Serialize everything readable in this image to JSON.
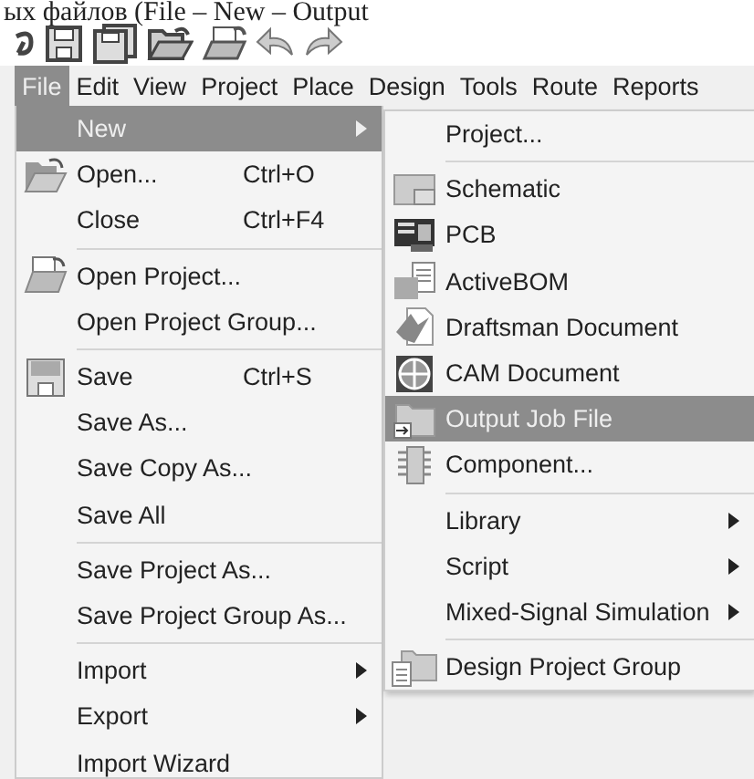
{
  "caption": "ых файлов (File – New – Output",
  "menubar": [
    {
      "label": "File",
      "selected": true
    },
    {
      "label": "Edit",
      "selected": false
    },
    {
      "label": "View",
      "selected": false
    },
    {
      "label": "Project",
      "selected": false
    },
    {
      "label": "Place",
      "selected": false
    },
    {
      "label": "Design",
      "selected": false
    },
    {
      "label": "Tools",
      "selected": false
    },
    {
      "label": "Route",
      "selected": false
    },
    {
      "label": "Reports",
      "selected": false
    }
  ],
  "file_menu": [
    {
      "label": "New",
      "submenu": true,
      "selected": true
    },
    {
      "label": "Open...",
      "shortcut": "Ctrl+O",
      "selected": false
    },
    {
      "label": "Close",
      "shortcut": "Ctrl+F4",
      "selected": false,
      "separator_after": true
    },
    {
      "label": "Open Project...",
      "selected": false
    },
    {
      "label": "Open Project Group...",
      "selected": false,
      "separator_after": true
    },
    {
      "label": "Save",
      "shortcut": "Ctrl+S",
      "selected": false
    },
    {
      "label": "Save As...",
      "selected": false
    },
    {
      "label": "Save Copy As...",
      "selected": false
    },
    {
      "label": "Save All",
      "selected": false,
      "separator_after": true
    },
    {
      "label": "Save Project As...",
      "selected": false
    },
    {
      "label": "Save Project Group As...",
      "selected": false,
      "separator_after": true
    },
    {
      "label": "Import",
      "submenu": true,
      "selected": false
    },
    {
      "label": "Export",
      "submenu": true,
      "selected": false
    },
    {
      "label": "Import Wizard",
      "selected": false
    }
  ],
  "new_submenu": [
    {
      "label": "Project...",
      "selected": false,
      "separator_after": true
    },
    {
      "label": "Schematic",
      "selected": false
    },
    {
      "label": "PCB",
      "selected": false
    },
    {
      "label": "ActiveBOM",
      "selected": false
    },
    {
      "label": "Draftsman Document",
      "selected": false
    },
    {
      "label": "CAM Document",
      "selected": false
    },
    {
      "label": "Output Job File",
      "selected": true
    },
    {
      "label": "Component...",
      "selected": false,
      "separator_after": true
    },
    {
      "label": "Library",
      "submenu": true,
      "selected": false
    },
    {
      "label": "Script",
      "submenu": true,
      "selected": false
    },
    {
      "label": "Mixed-Signal Simulation",
      "submenu": true,
      "selected": false,
      "separator_after": true
    },
    {
      "label": "Design Project Group",
      "selected": false
    }
  ]
}
